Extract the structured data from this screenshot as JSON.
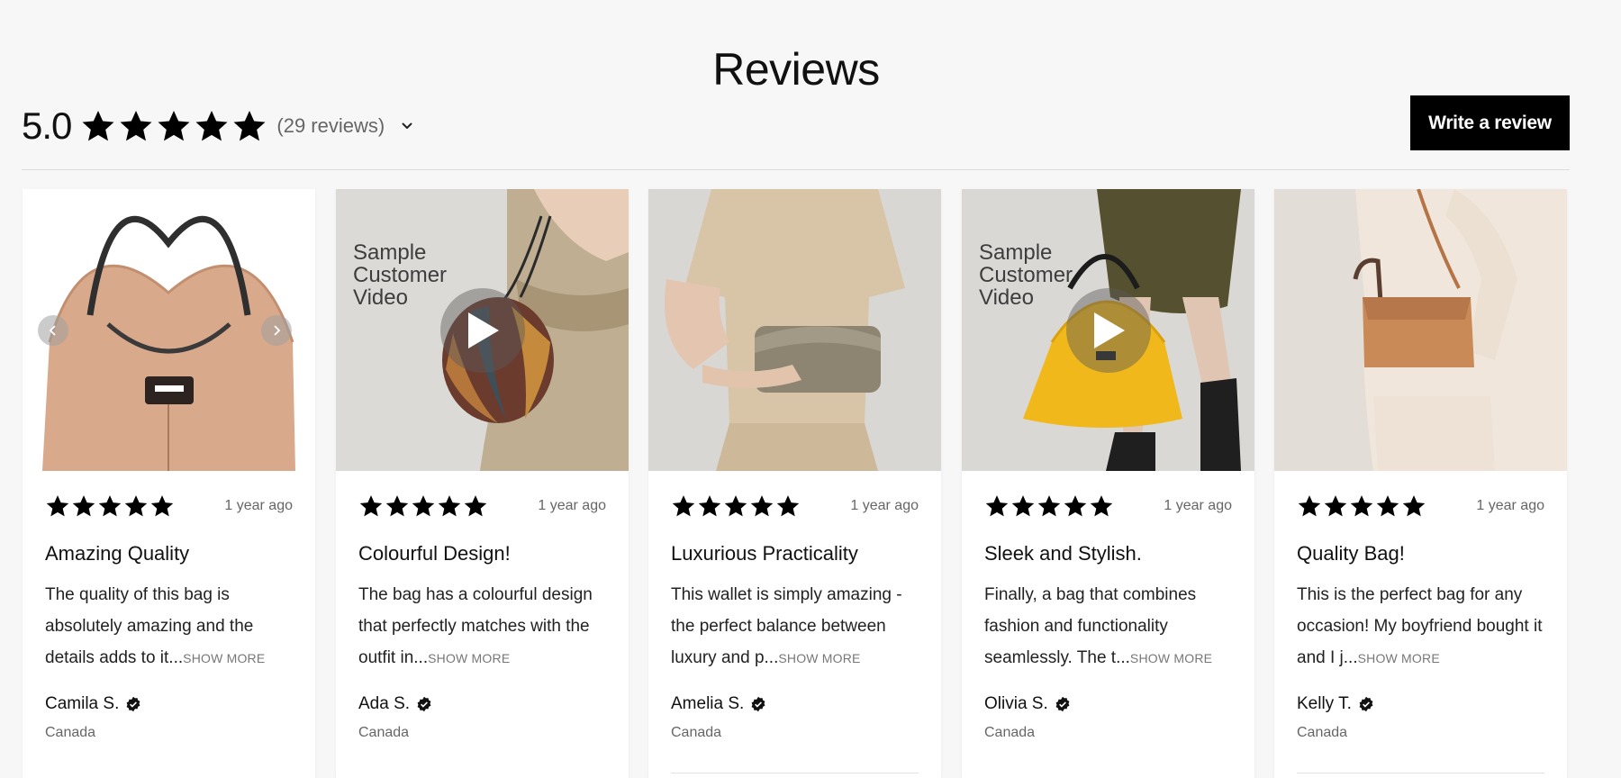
{
  "section": {
    "title": "Reviews"
  },
  "summary": {
    "rating": "5.0",
    "stars": 5,
    "count_text": "(29 reviews)",
    "write_review_label": "Write a review"
  },
  "colors": {
    "background": "#f7f7f7",
    "button": "#000000",
    "star": "#000000"
  },
  "reviews": [
    {
      "stars": 5,
      "date": "1 year ago",
      "title": "Amazing Quality",
      "text": "The quality of this bag is absolutely amazing and the details adds to it...",
      "show_more": "SHOW MORE",
      "author": "Camila S.",
      "country": "Canada",
      "media": "image-carousel",
      "video_overlay": ""
    },
    {
      "stars": 5,
      "date": "1 year ago",
      "title": "Colourful Design!",
      "text": "The bag has a colourful design that perfectly matches with the outfit in...",
      "show_more": "SHOW MORE",
      "author": "Ada S.",
      "country": "Canada",
      "media": "video",
      "video_overlay": "Sample\nCustomer\nVideo"
    },
    {
      "stars": 5,
      "date": "1 year ago",
      "title": "Luxurious Practicality",
      "text": "This wallet is simply amazing - the perfect balance between luxury and p...",
      "show_more": "SHOW MORE",
      "author": "Amelia S.",
      "country": "Canada",
      "media": "image",
      "video_overlay": ""
    },
    {
      "stars": 5,
      "date": "1 year ago",
      "title": "Sleek and Stylish.",
      "text": "Finally, a bag that combines fashion and functionality seamlessly. The t...",
      "show_more": "SHOW MORE",
      "author": "Olivia S.",
      "country": "Canada",
      "media": "video",
      "video_overlay": "Sample\nCustomer\nVideo"
    },
    {
      "stars": 5,
      "date": "1 year ago",
      "title": "Quality Bag!",
      "text": "This is the perfect bag for any occasion! My boyfriend bought it and I j...",
      "show_more": "SHOW MORE",
      "author": "Kelly T.",
      "country": "Canada",
      "media": "image",
      "video_overlay": ""
    }
  ],
  "icons": {
    "star": "star-icon",
    "verified": "verified-badge-icon",
    "play": "play-icon",
    "chevron": "chevron-down-icon",
    "prev": "chevron-left-icon",
    "next": "chevron-right-icon"
  }
}
